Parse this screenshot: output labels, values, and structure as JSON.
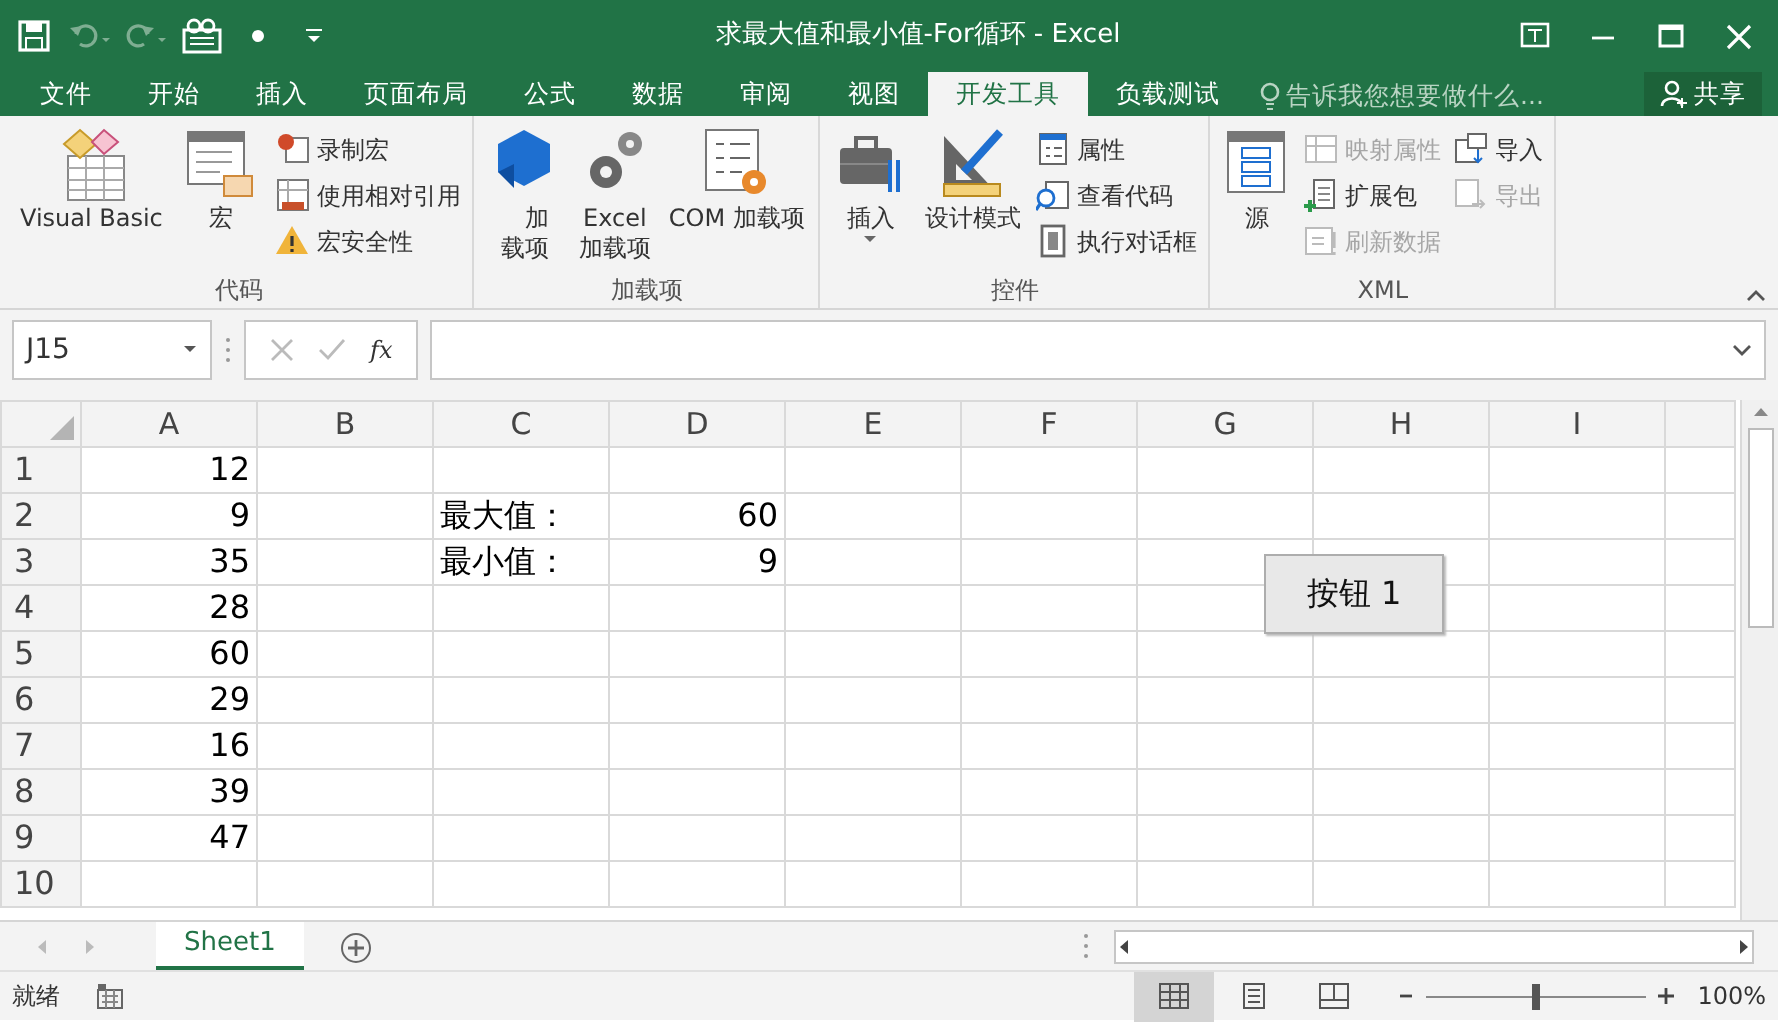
{
  "window": {
    "title": "求最大值和最小值-For循环 - Excel"
  },
  "ribbon_tabs": [
    {
      "label": "文件",
      "selected": false
    },
    {
      "label": "开始",
      "selected": false
    },
    {
      "label": "插入",
      "selected": false
    },
    {
      "label": "页面布局",
      "selected": false
    },
    {
      "label": "公式",
      "selected": false
    },
    {
      "label": "数据",
      "selected": false
    },
    {
      "label": "审阅",
      "selected": false
    },
    {
      "label": "视图",
      "selected": false
    },
    {
      "label": "开发工具",
      "selected": true
    },
    {
      "label": "负载测试",
      "selected": false
    }
  ],
  "tell_me": {
    "placeholder": "告诉我您想要做什么..."
  },
  "share_button": "共享",
  "ribbon_groups": [
    {
      "name": "代码",
      "columns": [
        {
          "kind": "large",
          "label": "Visual Basic"
        },
        {
          "kind": "large",
          "label": "宏"
        },
        {
          "kind": "stack",
          "items": [
            {
              "label": "录制宏",
              "disabled": false
            },
            {
              "label": "使用相对引用",
              "disabled": false
            },
            {
              "label": "宏安全性",
              "disabled": false
            }
          ]
        }
      ]
    },
    {
      "name": "加载项",
      "columns": [
        {
          "kind": "large",
          "label": "加载项",
          "narrow": true
        },
        {
          "kind": "large",
          "label": "Excel\n加载项"
        },
        {
          "kind": "large",
          "label": "COM 加载项"
        }
      ]
    },
    {
      "name": "控件",
      "columns": [
        {
          "kind": "large",
          "label": "插入",
          "dropdown": true
        },
        {
          "kind": "large",
          "label": "设计模式"
        },
        {
          "kind": "stack",
          "items": [
            {
              "label": "属性",
              "disabled": false
            },
            {
              "label": "查看代码",
              "disabled": false
            },
            {
              "label": "执行对话框",
              "disabled": false
            }
          ]
        }
      ]
    },
    {
      "name": "XML",
      "columns": [
        {
          "kind": "large",
          "label": "源"
        },
        {
          "kind": "stack",
          "items": [
            {
              "label": "映射属性",
              "disabled": true
            },
            {
              "label": "扩展包",
              "disabled": false
            },
            {
              "label": "刷新数据",
              "disabled": true
            }
          ]
        },
        {
          "kind": "stack",
          "items": [
            {
              "label": "导入",
              "disabled": false
            },
            {
              "label": "导出",
              "disabled": true
            }
          ]
        }
      ]
    }
  ],
  "name_box": "J15",
  "formula_bar": {
    "fx": "fx"
  },
  "columns": [
    "A",
    "B",
    "C",
    "D",
    "E",
    "F",
    "G",
    "H",
    "I"
  ],
  "rows": [
    {
      "number": "1",
      "column_a": "12"
    },
    {
      "number": "2",
      "column_a": "9",
      "column_c": "最大值：",
      "column_d": "60"
    },
    {
      "number": "3",
      "column_a": "35",
      "column_c": "最小值：",
      "column_d": "9"
    },
    {
      "number": "4",
      "column_a": "28"
    },
    {
      "number": "5",
      "column_a": "60"
    },
    {
      "number": "6",
      "column_a": "29"
    },
    {
      "number": "7",
      "column_a": "16"
    },
    {
      "number": "8",
      "column_a": "39"
    },
    {
      "number": "9",
      "column_a": "47"
    },
    {
      "number": "10"
    }
  ],
  "form_button": {
    "label": "按钮 1"
  },
  "sheet_tabs": [
    {
      "label": "Sheet1",
      "selected": true
    }
  ],
  "status_bar": {
    "status": "就绪",
    "views": [
      {
        "selected": true
      },
      {
        "selected": false
      },
      {
        "selected": false
      }
    ],
    "zoom": {
      "level": 0.5
    },
    "zoom_text": "100%"
  }
}
